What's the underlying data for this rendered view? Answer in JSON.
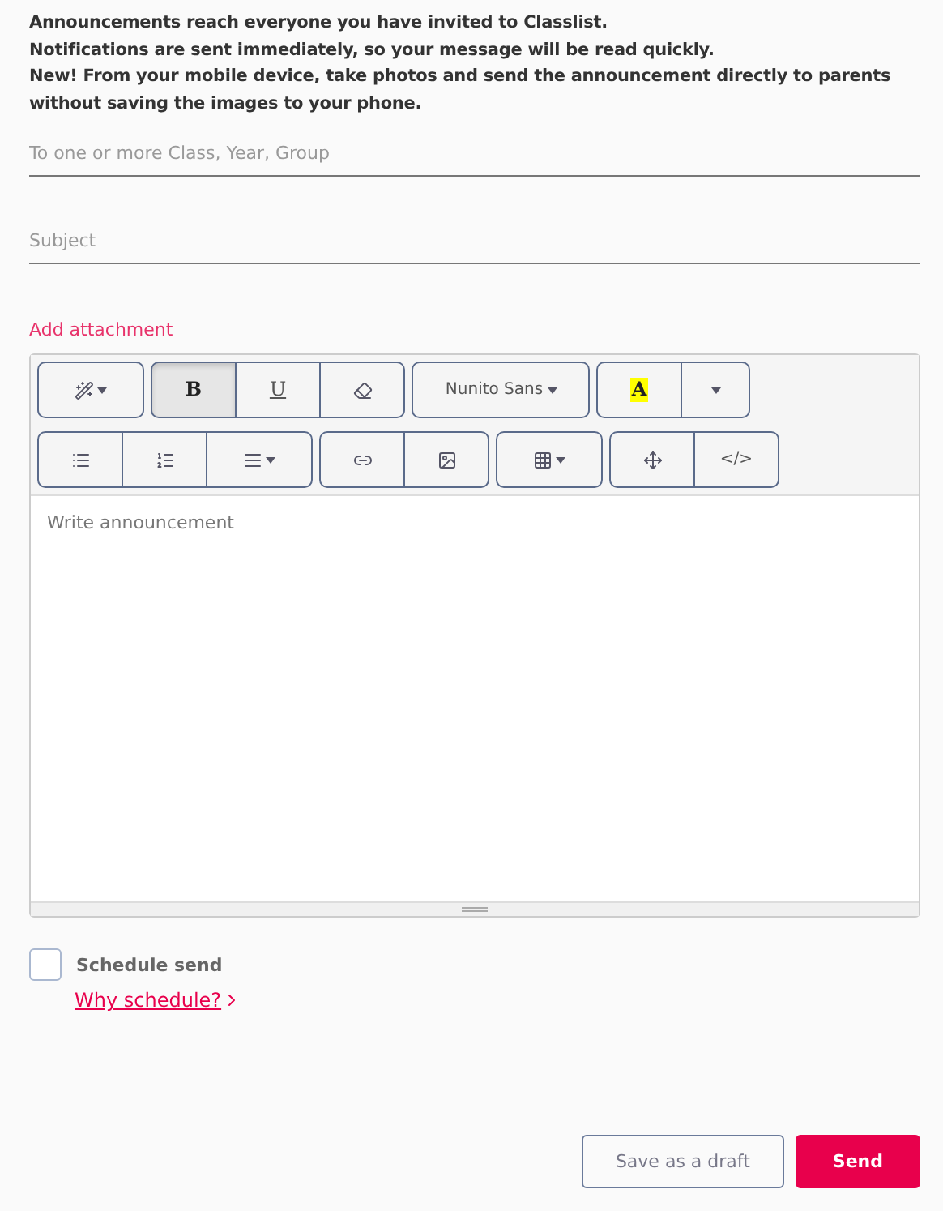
{
  "intro": [
    "Announcements reach everyone you have invited to Classlist.",
    "Notifications are sent immediately, so your message will be read quickly.",
    "New! From your mobile device, take photos and send the announcement directly to parents without saving the images to your phone."
  ],
  "recipients": {
    "placeholder": "To one or more Class, Year, Group"
  },
  "subject": {
    "placeholder": "Subject"
  },
  "attachment_link": "Add attachment",
  "toolbar": [
    [
      [
        {
          "kind": "wand",
          "caret": true,
          "selected": false
        }
      ],
      [
        {
          "kind": "bold",
          "label": "B",
          "selected": true
        },
        {
          "kind": "underline",
          "label": "U",
          "selected": false
        },
        {
          "kind": "eraser",
          "selected": false
        }
      ],
      [
        {
          "kind": "font",
          "label": "Nunito Sans",
          "caret": true,
          "selected": false
        }
      ],
      [
        {
          "kind": "highlight",
          "label": "A",
          "selected": false
        },
        {
          "kind": "caret",
          "selected": false
        }
      ]
    ],
    [
      [
        {
          "kind": "bullets",
          "selected": false
        },
        {
          "kind": "numbers",
          "selected": false
        },
        {
          "kind": "align",
          "caret": true,
          "selected": false
        }
      ],
      [
        {
          "kind": "link",
          "selected": false
        },
        {
          "kind": "image",
          "selected": false
        }
      ],
      [
        {
          "kind": "table",
          "caret": true,
          "selected": false
        }
      ],
      [
        {
          "kind": "fullscreen",
          "selected": false
        },
        {
          "kind": "code",
          "label": "</>",
          "selected": false
        }
      ]
    ]
  ],
  "editor": {
    "placeholder": "Write announcement"
  },
  "schedule": {
    "label": "Schedule send",
    "checked": false,
    "link": "Why schedule?"
  },
  "buttons": [
    {
      "kind": "secondary",
      "label": "Save as a draft"
    },
    {
      "kind": "primary",
      "label": "Send"
    }
  ]
}
